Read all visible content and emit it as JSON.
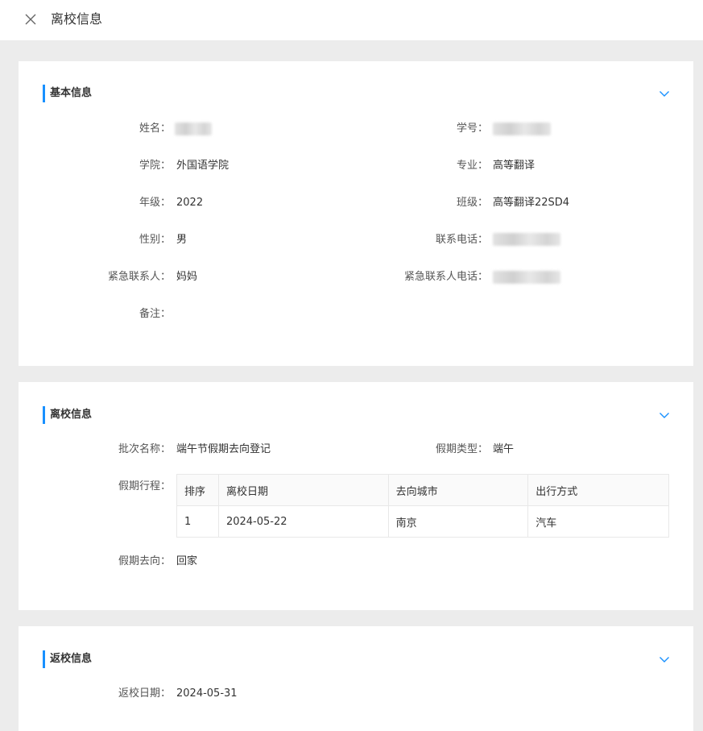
{
  "header": {
    "title": "离校信息"
  },
  "basic": {
    "section_title": "基本信息",
    "name_label": "姓名：",
    "name_value": "",
    "student_id_label": "学号：",
    "college_label": "学院：",
    "college_value": "外国语学院",
    "major_label": "专业：",
    "major_value": "高等翻译",
    "grade_label": "年级：",
    "grade_value": "2022",
    "class_label": "班级：",
    "class_value": "高等翻译22SD4",
    "gender_label": "性别：",
    "gender_value": "男",
    "phone_label": "联系电话：",
    "emergency_contact_label": "紧急联系人：",
    "emergency_contact_value": "妈妈",
    "emergency_phone_label": "紧急联系人电话：",
    "remark_label": "备注：",
    "remark_value": ""
  },
  "leave": {
    "section_title": "离校信息",
    "batch_label": "批次名称：",
    "batch_value": "端午节假期去向登记",
    "holiday_type_label": "假期类型：",
    "holiday_type_value": "端午",
    "itinerary_label": "假期行程：",
    "table": {
      "columns": [
        "排序",
        "离校日期",
        "去向城市",
        "出行方式"
      ],
      "rows": [
        [
          "1",
          "2024-05-22",
          "南京",
          "汽车"
        ]
      ]
    },
    "destination_label": "假期去向：",
    "destination_value": "回家"
  },
  "return": {
    "section_title": "返校信息",
    "return_date_label": "返校日期：",
    "return_date_value": "2024-05-31"
  },
  "colors": {
    "accent": "#1890ff",
    "background": "#ececec"
  },
  "icons": {
    "close": "close-icon",
    "collapse": "chevron-down-icon"
  }
}
